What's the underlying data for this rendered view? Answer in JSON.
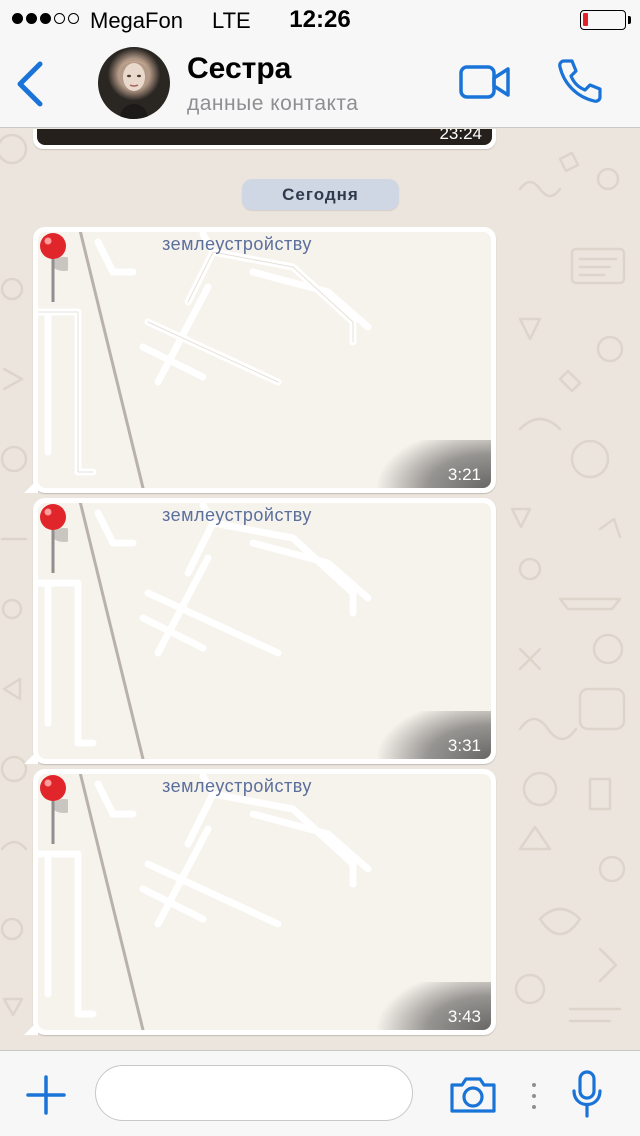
{
  "status_bar": {
    "carrier": "MegaFon",
    "network": "LTE",
    "time": "12:26",
    "signal_bars_filled": 3,
    "signal_bars_total": 5,
    "battery_level": 0.1,
    "battery_color": "#e3232a"
  },
  "header": {
    "contact_name": "Сестра",
    "contact_subtitle": "данные контакта",
    "accent_color": "#1a74d8",
    "icons": [
      "back-chevron-icon",
      "avatar",
      "video-camera-icon",
      "phone-icon"
    ]
  },
  "chat": {
    "previous_message_time": "23:24",
    "date_separator": "Сегодня",
    "messages": [
      {
        "type": "location",
        "map_label": "землеустройству",
        "time": "3:21"
      },
      {
        "type": "location",
        "map_label": "землеустройству",
        "time": "3:31"
      },
      {
        "type": "location",
        "map_label": "землеустройству",
        "time": "3:43"
      }
    ]
  },
  "input_bar": {
    "placeholder": "",
    "icons": [
      "plus-icon",
      "camera-icon",
      "more-dots-icon",
      "microphone-icon"
    ]
  }
}
